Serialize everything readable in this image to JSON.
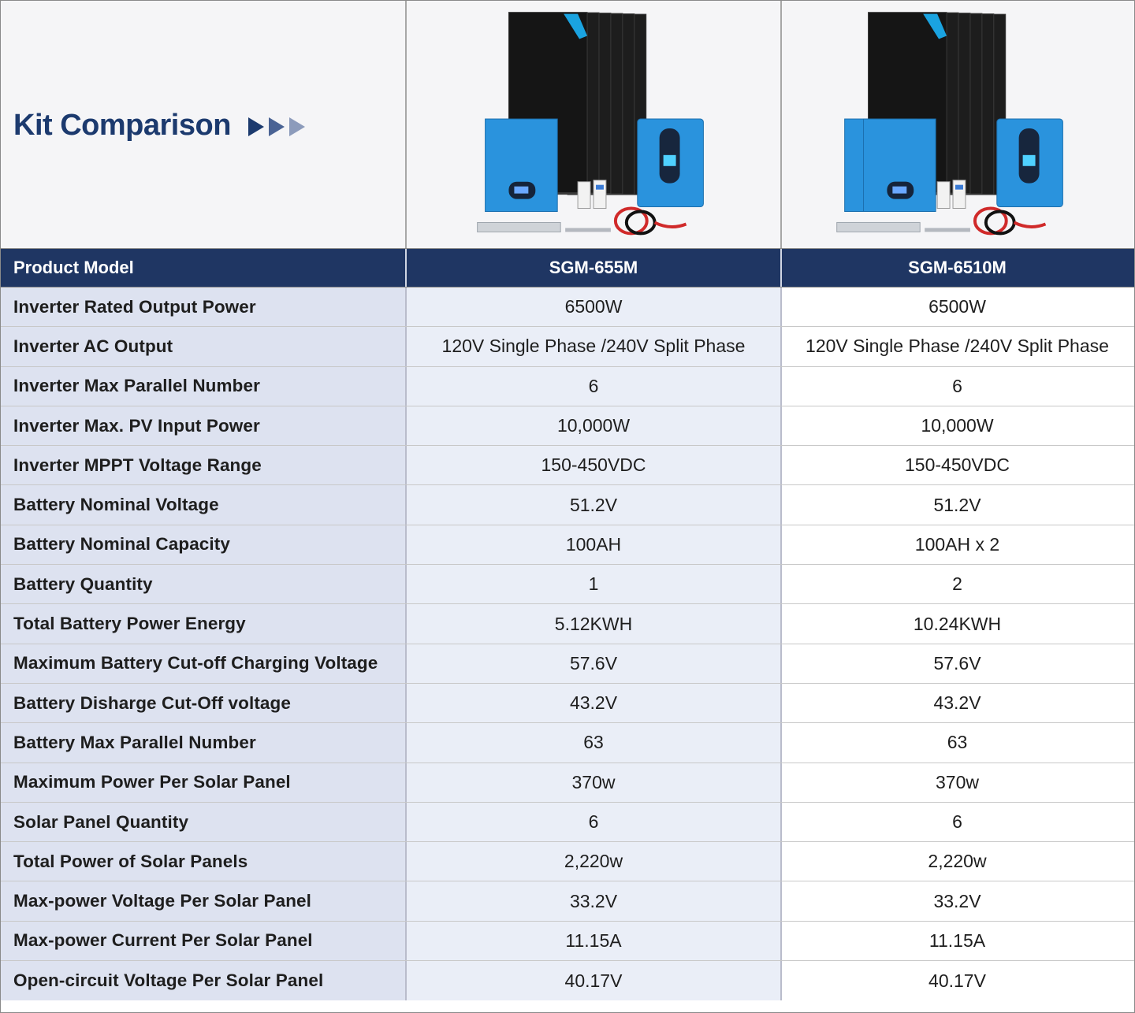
{
  "title": "Kit Comparison",
  "colors": {
    "header_bg": "#1f3663",
    "title": "#1c3a6e",
    "label_bg": "#dde2f0",
    "col1_bg": "#eaeef7",
    "col2_bg": "#ffffff"
  },
  "header": {
    "label": "Product Model",
    "models": [
      "SGM-655M",
      "SGM-6510M"
    ]
  },
  "images": [
    {
      "name": "kit-image-sgm-655m",
      "battery_count": 1
    },
    {
      "name": "kit-image-sgm-6510m",
      "battery_count": 2
    }
  ],
  "rows": [
    {
      "label": "Inverter Rated Output Power",
      "values": [
        "6500W",
        "6500W"
      ]
    },
    {
      "label": "Inverter AC Output",
      "values": [
        "120V Single Phase /240V Split Phase",
        "120V Single Phase /240V Split Phase"
      ]
    },
    {
      "label": "Inverter Max Parallel Number",
      "values": [
        "6",
        "6"
      ]
    },
    {
      "label": "Inverter Max. PV Input Power",
      "values": [
        "10,000W",
        "10,000W"
      ]
    },
    {
      "label": "Inverter MPPT Voltage Range",
      "values": [
        "150-450VDC",
        "150-450VDC"
      ]
    },
    {
      "label": "Battery Nominal Voltage",
      "values": [
        "51.2V",
        "51.2V"
      ]
    },
    {
      "label": "Battery Nominal Capacity",
      "values": [
        "100AH",
        "100AH x 2"
      ]
    },
    {
      "label": "Battery Quantity",
      "values": [
        "1",
        "2"
      ]
    },
    {
      "label": "Total Battery Power Energy",
      "values": [
        "5.12KWH",
        "10.24KWH"
      ]
    },
    {
      "label": "Maximum Battery Cut-off  Charging Voltage",
      "values": [
        "57.6V",
        "57.6V"
      ]
    },
    {
      "label": "Battery Disharge Cut-Off voltage",
      "values": [
        "43.2V",
        "43.2V"
      ]
    },
    {
      "label": "Battery Max Parallel Number",
      "values": [
        "63",
        "63"
      ]
    },
    {
      "label": "Maximum Power Per Solar Panel",
      "values": [
        "370w",
        "370w"
      ]
    },
    {
      "label": "Solar Panel Quantity",
      "values": [
        "6",
        "6"
      ]
    },
    {
      "label": "Total Power of Solar Panels",
      "values": [
        "2,220w",
        "2,220w"
      ]
    },
    {
      "label": "Max-power Voltage Per Solar Panel",
      "values": [
        "33.2V",
        "33.2V"
      ]
    },
    {
      "label": "Max-power Current Per Solar Panel",
      "values": [
        "11.15A",
        "11.15A"
      ]
    },
    {
      "label": "Open-circuit Voltage Per Solar Panel",
      "values": [
        "40.17V",
        "40.17V"
      ]
    }
  ]
}
